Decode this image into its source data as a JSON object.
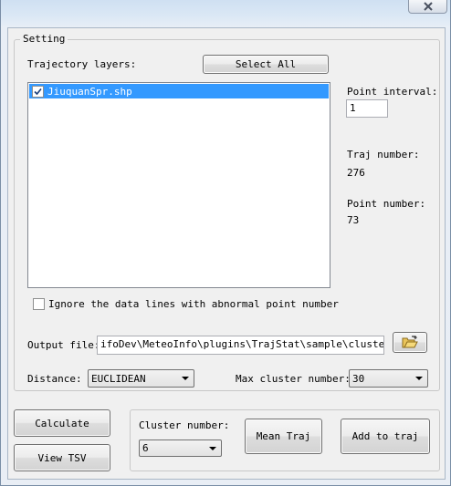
{
  "window": {
    "close_icon": "close-x-icon"
  },
  "setting": {
    "group_title": "Setting",
    "trajectory_layers_label": "Trajectory layers:",
    "select_all_label": "Select All",
    "layers": [
      {
        "name": "JiuquanSpr.shp",
        "checked": true
      }
    ],
    "point_interval_label": "Point interval:",
    "point_interval_value": "1",
    "traj_number_label": "Traj number:",
    "traj_number_value": "276",
    "point_number_label": "Point number:",
    "point_number_value": "73",
    "ignore_label": "Ignore the data lines with abnormal point number",
    "ignore_checked": false,
    "output_file_label": "Output file:",
    "output_file_value": "ifoDev\\MeteoInfo\\plugins\\TrajStat\\sample\\cluster.txt",
    "browse_icon": "open-folder-icon",
    "distance_label": "Distance:",
    "distance_value": "EUCLIDEAN",
    "max_cluster_label": "Max cluster number:",
    "max_cluster_value": "30"
  },
  "actions": {
    "calculate_label": "Calculate",
    "view_tsv_label": "View TSV",
    "cluster_number_label": "Cluster number:",
    "cluster_number_value": "6",
    "mean_traj_label": "Mean Traj",
    "add_to_traj_label": "Add to traj"
  }
}
